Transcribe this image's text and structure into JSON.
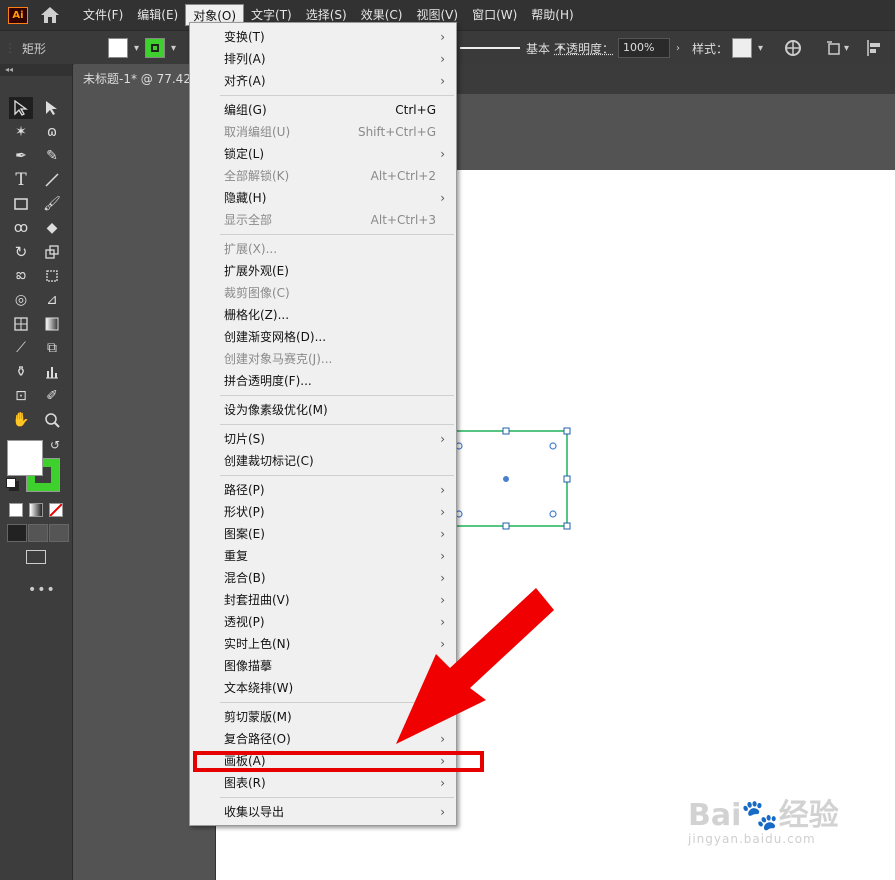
{
  "app": {
    "logo": "Ai"
  },
  "menubar": {
    "items": [
      {
        "label": "文件(F)"
      },
      {
        "label": "编辑(E)"
      },
      {
        "label": "对象(O)",
        "active": true
      },
      {
        "label": "文字(T)"
      },
      {
        "label": "选择(S)"
      },
      {
        "label": "效果(C)"
      },
      {
        "label": "视图(V)"
      },
      {
        "label": "窗口(W)"
      },
      {
        "label": "帮助(H)"
      }
    ]
  },
  "controlbar": {
    "shape_label": "矩形",
    "stroke_style": "基本",
    "opacity_label": "不透明度：",
    "opacity_value": "100%",
    "style_label": "样式："
  },
  "document": {
    "tab_title": "未标题-1* @ 77.42"
  },
  "colors": {
    "accent": "#3ed12e",
    "selection": "#1fb25a",
    "highlight": "#e60000",
    "menu_bg": "#f0f0f0"
  },
  "object_menu": [
    {
      "label": "变换(T)",
      "submenu": true
    },
    {
      "label": "排列(A)",
      "submenu": true
    },
    {
      "label": "对齐(A)",
      "submenu": true
    },
    {
      "sep": true
    },
    {
      "label": "编组(G)",
      "shortcut": "Ctrl+G"
    },
    {
      "label": "取消编组(U)",
      "shortcut": "Shift+Ctrl+G",
      "disabled": true
    },
    {
      "label": "锁定(L)",
      "submenu": true
    },
    {
      "label": "全部解锁(K)",
      "shortcut": "Alt+Ctrl+2",
      "disabled": true
    },
    {
      "label": "隐藏(H)",
      "submenu": true
    },
    {
      "label": "显示全部",
      "shortcut": "Alt+Ctrl+3",
      "disabled": true
    },
    {
      "sep": true
    },
    {
      "label": "扩展(X)...",
      "disabled": true
    },
    {
      "label": "扩展外观(E)"
    },
    {
      "label": "裁剪图像(C)",
      "disabled": true
    },
    {
      "label": "栅格化(Z)..."
    },
    {
      "label": "创建渐变网格(D)..."
    },
    {
      "label": "创建对象马赛克(J)...",
      "disabled": true
    },
    {
      "label": "拼合透明度(F)..."
    },
    {
      "sep": true
    },
    {
      "label": "设为像素级优化(M)"
    },
    {
      "sep": true
    },
    {
      "label": "切片(S)",
      "submenu": true
    },
    {
      "label": "创建裁切标记(C)"
    },
    {
      "sep": true
    },
    {
      "label": "路径(P)",
      "submenu": true
    },
    {
      "label": "形状(P)",
      "submenu": true
    },
    {
      "label": "图案(E)",
      "submenu": true
    },
    {
      "label": "重复",
      "submenu": true
    },
    {
      "label": "混合(B)",
      "submenu": true
    },
    {
      "label": "封套扭曲(V)",
      "submenu": true
    },
    {
      "label": "透视(P)",
      "submenu": true
    },
    {
      "label": "实时上色(N)",
      "submenu": true
    },
    {
      "label": "图像描摹",
      "submenu": true
    },
    {
      "label": "文本绕排(W)",
      "submenu": true
    },
    {
      "sep": true
    },
    {
      "label": "剪切蒙版(M)",
      "submenu": true
    },
    {
      "label": "复合路径(O)",
      "submenu": true
    },
    {
      "label": "画板(A)",
      "submenu": true,
      "highlighted": true
    },
    {
      "label": "图表(R)",
      "submenu": true
    },
    {
      "sep": true
    },
    {
      "label": "收集以导出",
      "submenu": true
    }
  ],
  "watermark": {
    "brand": "Bai",
    "brand_cn": "经验",
    "url": "jingyan.baidu.com"
  }
}
